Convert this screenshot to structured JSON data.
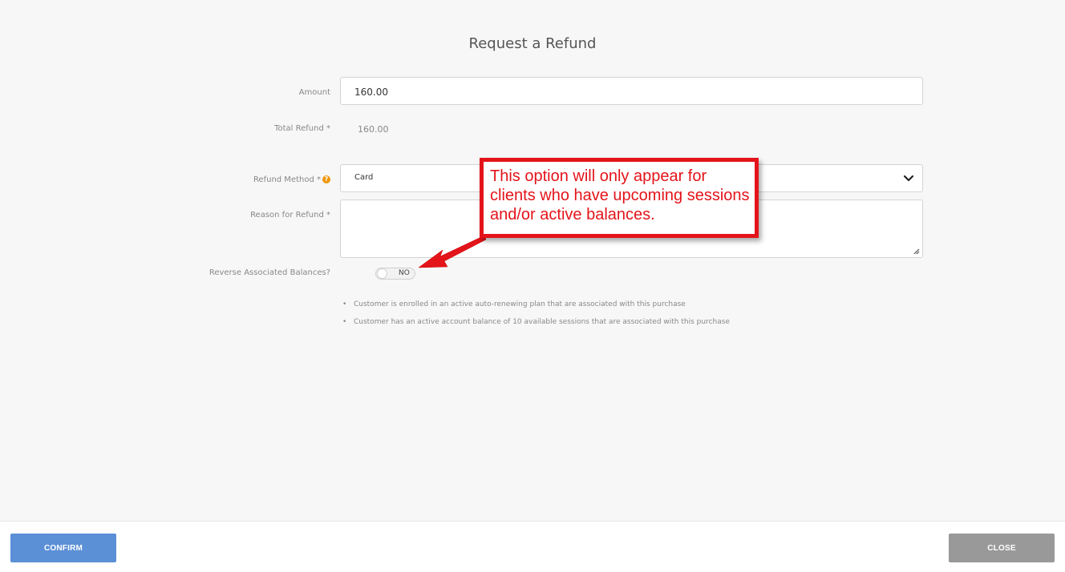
{
  "dialog": {
    "title": "Request a Refund"
  },
  "form": {
    "amount": {
      "label": "Amount",
      "value": "160.00"
    },
    "total_refund": {
      "label": "Total Refund *",
      "value": "160.00"
    },
    "refund_method": {
      "label": "Refund Method *",
      "help_icon": "?",
      "value": "Card"
    },
    "reason": {
      "label": "Reason for Refund *",
      "value": ""
    },
    "reverse_balances": {
      "label": "Reverse Associated Balances?",
      "toggle_value": "NO"
    },
    "notes": [
      "Customer is enrolled in an active auto-renewing plan that are associated with this purchase",
      "Customer has an active account balance of 10 available sessions that are associated with this purchase"
    ]
  },
  "annotation": {
    "text": "This option will only appear for clients who have upcoming sessions and/or active balances.",
    "color": "#e3141a"
  },
  "footer": {
    "confirm_label": "CONFIRM",
    "close_label": "CLOSE",
    "confirm_color": "#5b8fd6",
    "close_color": "#999999"
  },
  "icons": {
    "dropdown": "chevron-down-icon",
    "resize": "resize-handle-icon",
    "help": "help-icon",
    "arrow": "arrow-icon"
  }
}
